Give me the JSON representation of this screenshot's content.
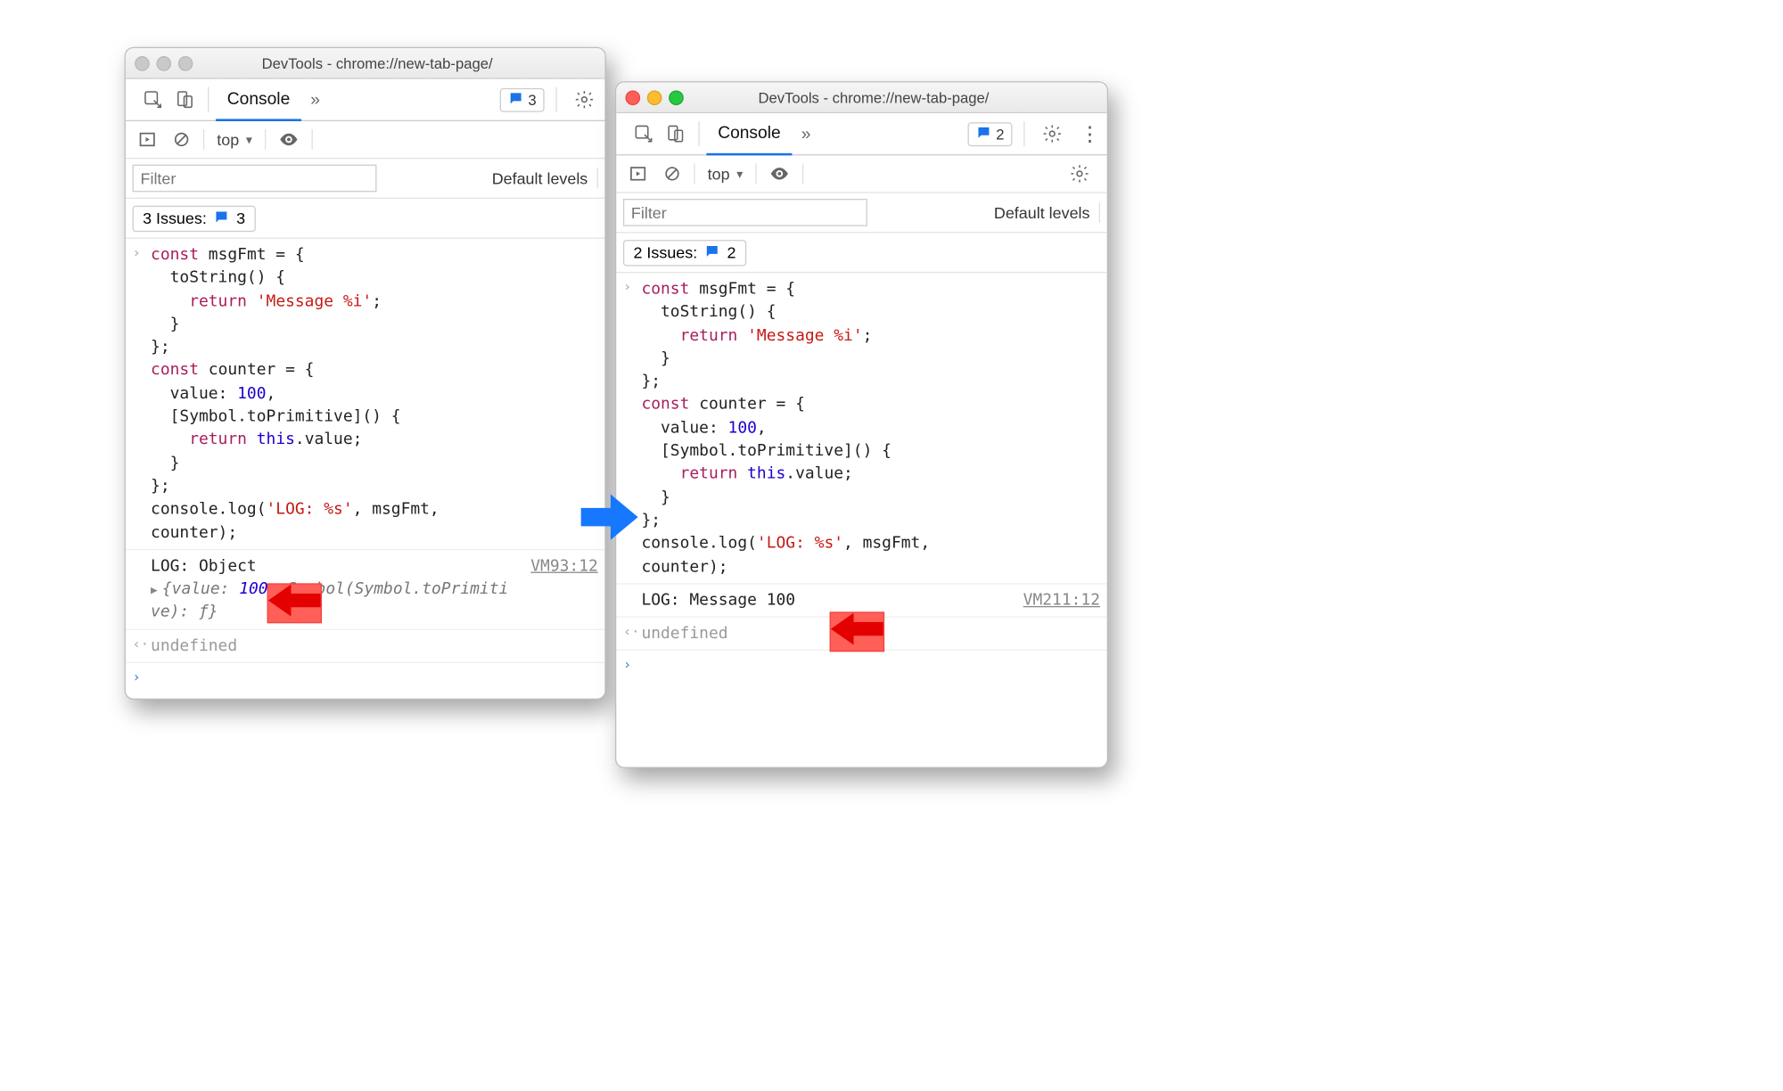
{
  "leftWindow": {
    "title": "DevTools - chrome://new-tab-page/",
    "activeTab": "Console",
    "badgeCount": "3",
    "context": "top",
    "filterPlaceholder": "Filter",
    "levels": "Default levels",
    "issuesLabel": "3 Issues:",
    "issuesCount": "3",
    "logOutput": "LOG: Object",
    "sourceRef": "VM93:12",
    "expandValue": "100",
    "undefined": "undefined"
  },
  "rightWindow": {
    "title": "DevTools - chrome://new-tab-page/",
    "activeTab": "Console",
    "badgeCount": "2",
    "context": "top",
    "filterPlaceholder": "Filter",
    "levels": "Default levels",
    "issuesLabel": "2 Issues:",
    "issuesCount": "2",
    "logOutput": "LOG: Message 100",
    "sourceRef": "VM211:12",
    "undefined": "undefined"
  },
  "code": {
    "l1a": "const",
    "l1b": " msgFmt = {",
    "l2": "  toString() {",
    "l3a": "    return",
    "l3b": " ",
    "l3c": "'Message %i'",
    "l3d": ";",
    "l4": "  }",
    "l5": "};",
    "l6a": "const",
    "l6b": " counter = {",
    "l7a": "  value: ",
    "l7b": "100",
    "l7c": ",",
    "l8": "  [Symbol.toPrimitive]() {",
    "l9a": "    return",
    "l9b": " ",
    "l9c": "this",
    "l9d": ".value;",
    "l10": "  }",
    "l11": "};",
    "l12a": "console.log(",
    "l12b": "'LOG: %s'",
    "l12c": ", msgFmt,",
    "l13": "counter);"
  },
  "expand": {
    "pre": "{value: ",
    "mid": ", Symbol(Symbol.toPrimiti",
    "end": "ve): ƒ}"
  }
}
